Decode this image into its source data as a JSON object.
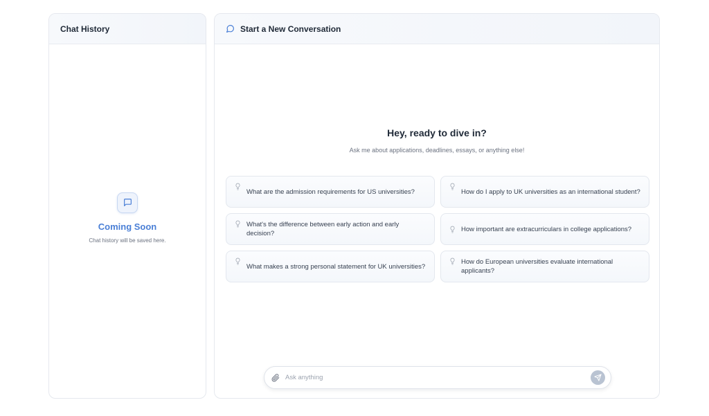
{
  "history": {
    "title": "Chat History",
    "coming_soon_title": "Coming Soon",
    "coming_soon_subtitle": "Chat history will be saved here."
  },
  "chat": {
    "header_title": "Start a New Conversation",
    "welcome_title": "Hey, ready to dive in?",
    "welcome_subtitle": "Ask me about applications, deadlines, essays, or anything else!",
    "suggestions": [
      {
        "text": "What are the admission requirements for US universities?"
      },
      {
        "text": "How do I apply to UK universities as an international student?"
      },
      {
        "text": "What's the difference between early action and early decision?"
      },
      {
        "text": "How important are extracurriculars in college applications?"
      },
      {
        "text": "What makes a strong personal statement for UK universities?"
      },
      {
        "text": "How do European universities evaluate international applicants?"
      }
    ],
    "input": {
      "placeholder": "Ask anything",
      "value": ""
    }
  },
  "colors": {
    "accent": "#4a7fd6",
    "send_button": "#b9c3d2"
  },
  "icons": {
    "header": "chat-bubble-icon",
    "coming_soon": "message-square-icon",
    "suggestion": "lightbulb-icon",
    "attach": "paperclip-icon",
    "send": "send-icon"
  }
}
